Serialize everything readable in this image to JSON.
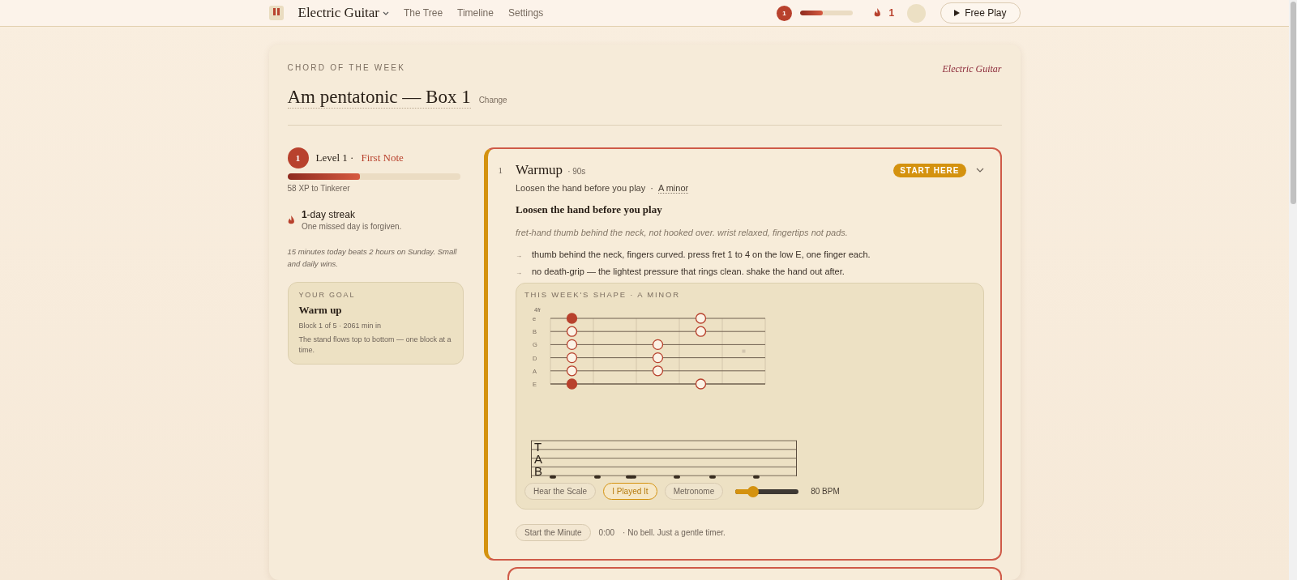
{
  "header": {
    "instrument": "Electric Guitar",
    "nav": [
      "The Tree",
      "Timeline",
      "Settings"
    ],
    "level_badge": "1",
    "xp": {
      "level": 0.43
    },
    "streak": "1",
    "action": "Free Play"
  },
  "week": {
    "eyebrow": "CHORD OF THE WEEK",
    "instrument": "Electric Guitar",
    "title": "Am pentatonic — Box 1",
    "change": "Change"
  },
  "progress": {
    "badge": "1",
    "level_label": "Level 1 ·",
    "rank": "First Note",
    "level": 0.42,
    "xp_note": "58 XP to Tinkerer",
    "streak_title": "**1**-day streak",
    "streak_note": "One missed day is forgiven.",
    "quote": "15 minutes today beats 2 hours on Sunday. Small and daily wins."
  },
  "goal": {
    "eyebrow": "YOUR GOAL",
    "title": "Warm up",
    "meta": "Block 1 of 5 · 2061 min in",
    "note": "The stand flows top to bottom — one block at a time."
  },
  "block": {
    "number": "1",
    "title": "Warmup",
    "duration": "· 90s",
    "badge": "START HERE",
    "expanded": true,
    "subtitle": "Loosen the hand before you play",
    "separator": "·",
    "key": "A minor",
    "heading": "Loosen the hand before you play",
    "cue": "fret-hand thumb behind the neck, not hooked over. wrist relaxed, fingertips not pads.",
    "steps": [
      {
        "arrow": "→",
        "text": "thumb behind the neck, fingers curved. press fret 1 to 4 on the low E, one finger each."
      },
      {
        "arrow": "→",
        "text": "no death-grip — the lightest pressure that rings clean. shake the hand out after."
      }
    ],
    "shape": {
      "title": "THIS WEEK'S SHAPE · A MINOR",
      "position": "4fr",
      "strings": [
        {
          "label": "e",
          "frets": [
            {
              "kind": "root"
            },
            {
              "kind": "empty"
            },
            {
              "kind": "empty"
            },
            {
              "kind": "note"
            },
            {
              "kind": "empty"
            }
          ]
        },
        {
          "label": "B",
          "frets": [
            {
              "kind": "note"
            },
            {
              "kind": "empty"
            },
            {
              "kind": "empty"
            },
            {
              "kind": "note"
            },
            {
              "kind": "empty"
            }
          ]
        },
        {
          "label": "G",
          "frets": [
            {
              "kind": "note"
            },
            {
              "kind": "empty"
            },
            {
              "kind": "note"
            },
            {
              "kind": "empty"
            },
            {
              "kind": "empty"
            }
          ]
        },
        {
          "label": "D",
          "frets": [
            {
              "kind": "note"
            },
            {
              "kind": "empty"
            },
            {
              "kind": "note"
            },
            {
              "kind": "empty"
            },
            {
              "kind": "empty"
            }
          ]
        },
        {
          "label": "A",
          "frets": [
            {
              "kind": "note"
            },
            {
              "kind": "empty"
            },
            {
              "kind": "note"
            },
            {
              "kind": "empty"
            },
            {
              "kind": "empty"
            }
          ]
        },
        {
          "label": "E",
          "frets": [
            {
              "kind": "root"
            },
            {
              "kind": "empty"
            },
            {
              "kind": "empty"
            },
            {
              "kind": "note"
            },
            {
              "kind": "empty"
            }
          ]
        }
      ],
      "tab_clef": [
        "T",
        "A",
        "B"
      ],
      "controls": [
        {
          "label": "Hear the Scale",
          "selected": false
        },
        {
          "label": "I Played It",
          "selected": true
        },
        {
          "label": "Metronome",
          "selected": false
        }
      ],
      "tempo": {
        "level": 0.28,
        "reading": "80 BPM"
      }
    },
    "timer": {
      "button": "Start the Minute",
      "time": "0:00",
      "note": "· No bell. Just a gentle timer."
    }
  }
}
